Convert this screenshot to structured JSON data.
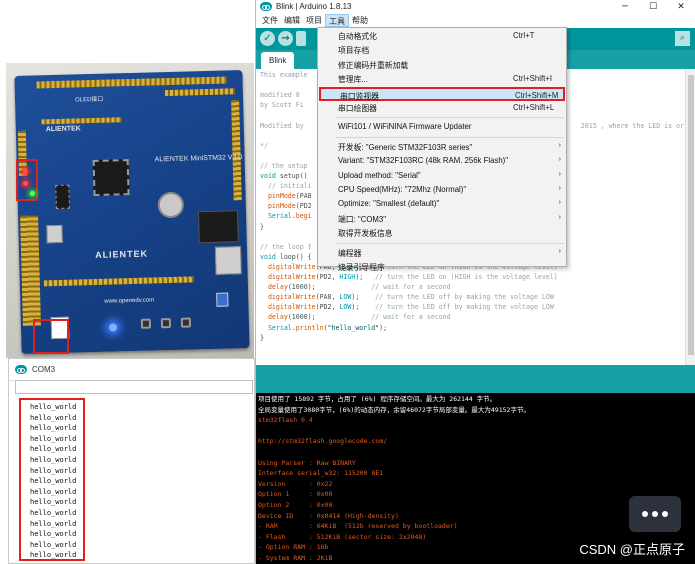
{
  "serial_window": {
    "title": "COM3",
    "output_lines": [
      "hello_world",
      "hello_world",
      "hello_world",
      "hello_world",
      "hello_world",
      "hello_world",
      "hello_world",
      "hello_world",
      "hello_world",
      "hello_world",
      "hello_world",
      "hello_world",
      "hello_world",
      "hello_world",
      "hello_world"
    ]
  },
  "board": {
    "brand": "ALIENTEK",
    "model": "ALIENTEK MiniSTM32 V3.0",
    "oled_label": "OLED接口",
    "website": "www.openedv.com"
  },
  "ide": {
    "window_title": "Blink | Arduino 1.8.13",
    "window_controls": [
      "─",
      "☐",
      "✕"
    ],
    "menu": [
      "文件",
      "编辑",
      "项目",
      "工具",
      "帮助"
    ],
    "active_menu_index": 3,
    "tab": "Blink",
    "code_lines": [
      {
        "y": 0,
        "parts": [
          [
            "This example",
            "cm"
          ]
        ]
      },
      {
        "y": 2,
        "parts": [
          [
            "modified 8",
            "cm"
          ]
        ]
      },
      {
        "y": 3,
        "parts": [
          [
            "by Scott Fi",
            "cm"
          ]
        ]
      },
      {
        "y": 5,
        "parts": [
          [
            "Modified by",
            "cm"
          ]
        ]
      },
      {
        "y": 5.01,
        "parts": [
          [
            "2015 , where the LED is or",
            "cm"
          ]
        ],
        "x": "right"
      },
      {
        "y": 7,
        "parts": [
          [
            "*/",
            "cm"
          ]
        ]
      },
      {
        "y": 9,
        "parts": [
          [
            "// the setup",
            "cm"
          ]
        ]
      },
      {
        "y": 10,
        "parts": [
          [
            "void",
            "kw"
          ],
          [
            " setup() ",
            "tx"
          ]
        ]
      },
      {
        "y": 11,
        "parts": [
          [
            "  // initiali",
            "cm"
          ]
        ]
      },
      {
        "y": 12,
        "parts": [
          [
            "  ",
            "tx"
          ],
          [
            "pinMode",
            "fn"
          ],
          [
            "(PA8",
            "tx"
          ]
        ]
      },
      {
        "y": 13,
        "parts": [
          [
            "  ",
            "tx"
          ],
          [
            "pinMode",
            "fn"
          ],
          [
            "(PD2",
            "tx"
          ]
        ]
      },
      {
        "y": 14,
        "parts": [
          [
            "  ",
            "tx"
          ],
          [
            "Serial",
            "kw"
          ],
          [
            ".",
            "tx"
          ],
          [
            "begi",
            "fn"
          ]
        ]
      },
      {
        "y": 15,
        "parts": [
          [
            "}",
            "tx"
          ]
        ]
      },
      {
        "y": 17,
        "parts": [
          [
            "// the loop f",
            "cm"
          ]
        ]
      },
      {
        "y": 18,
        "parts": [
          [
            "void",
            "kw"
          ],
          [
            " loop() {",
            "tx"
          ]
        ]
      },
      {
        "y": 19,
        "parts": [
          [
            "  ",
            "tx"
          ],
          [
            "digitalWrite",
            "fn"
          ],
          [
            "(PA8, ",
            "tx"
          ],
          [
            "HIGH",
            "cn"
          ],
          [
            ");   ",
            "tx"
          ],
          [
            "// turn the LED on (HIGH is the voltage level)",
            "cm"
          ]
        ]
      },
      {
        "y": 20,
        "parts": [
          [
            "  ",
            "tx"
          ],
          [
            "digitalWrite",
            "fn"
          ],
          [
            "(PD2, ",
            "tx"
          ],
          [
            "HIGH",
            "cn"
          ],
          [
            ");   ",
            "tx"
          ],
          [
            "// turn the LED on (HIGH is the voltage level)",
            "cm"
          ]
        ]
      },
      {
        "y": 21,
        "parts": [
          [
            "  ",
            "tx"
          ],
          [
            "delay",
            "fn"
          ],
          [
            "(1000);              ",
            "tx"
          ],
          [
            "// wait for a second",
            "cm"
          ]
        ]
      },
      {
        "y": 22,
        "parts": [
          [
            "  ",
            "tx"
          ],
          [
            "digitalWrite",
            "fn"
          ],
          [
            "(PA8, ",
            "tx"
          ],
          [
            "LOW",
            "cn"
          ],
          [
            ");    ",
            "tx"
          ],
          [
            "// turn the LED off by making the voltage LOW",
            "cm"
          ]
        ]
      },
      {
        "y": 23,
        "parts": [
          [
            "  ",
            "tx"
          ],
          [
            "digitalWrite",
            "fn"
          ],
          [
            "(PD2, ",
            "tx"
          ],
          [
            "LOW",
            "cn"
          ],
          [
            ");    ",
            "tx"
          ],
          [
            "// turn the LED off by making the voltage LOW",
            "cm"
          ]
        ]
      },
      {
        "y": 24,
        "parts": [
          [
            "  ",
            "tx"
          ],
          [
            "delay",
            "fn"
          ],
          [
            "(1000);              ",
            "tx"
          ],
          [
            "// wait for a second",
            "cm"
          ]
        ]
      },
      {
        "y": 25,
        "parts": [
          [
            "  ",
            "tx"
          ],
          [
            "Serial",
            "kw"
          ],
          [
            ".",
            "tx"
          ],
          [
            "println",
            "fn"
          ],
          [
            "(",
            "tx"
          ],
          [
            "\"hello_world\"",
            "st"
          ],
          [
            ");",
            "tx"
          ]
        ]
      },
      {
        "y": 26,
        "parts": [
          [
            "}",
            "tx"
          ]
        ]
      }
    ],
    "console_lines": [
      {
        "text": "项目使用了 15892 字节，占用了 (6%) 程序存储空间。最大为 262144 字节。",
        "c": "w"
      },
      {
        "text": "全局变量使用了3080字节，(6%)的动态内存，余留46072字节局部变量。最大为49152字节。",
        "c": "w"
      },
      {
        "text": "stm32flash 0.4",
        "c": "o"
      },
      {
        "text": "",
        "c": "o"
      },
      {
        "text": "http://stm32flash.googlecode.com/",
        "c": "o"
      },
      {
        "text": "",
        "c": "o"
      },
      {
        "text": "Using Parser : Raw BINARY",
        "c": "o"
      },
      {
        "text": "Interface serial_w32: 115200 8E1",
        "c": "o"
      },
      {
        "text": "Version      : 0x22",
        "c": "o"
      },
      {
        "text": "Option 1     : 0x00",
        "c": "o"
      },
      {
        "text": "Option 2     : 0x00",
        "c": "o"
      },
      {
        "text": "Device ID    : 0x0414 (High-density)",
        "c": "o"
      },
      {
        "text": "- RAM        : 64KiB  (512b reserved by bootloader)",
        "c": "o"
      },
      {
        "text": "- Flash      : 512KiB (sector size: 2x2048)",
        "c": "o"
      },
      {
        "text": "- Option RAM : 16b",
        "c": "o"
      },
      {
        "text": "- System RAM : 2KiB",
        "c": "o"
      }
    ],
    "watermark": "CSDN @正点原子"
  },
  "tools_menu": {
    "items": [
      {
        "label": "自动格式化",
        "shortcut": "Ctrl+T",
        "sub": false,
        "sep_after": false
      },
      {
        "label": "项目存档",
        "shortcut": "",
        "sub": false,
        "sep_after": false
      },
      {
        "label": "修正编码并重新加载",
        "shortcut": "",
        "sub": false,
        "sep_after": false
      },
      {
        "label": "管理库...",
        "shortcut": "Ctrl+Shift+I",
        "sub": false,
        "sep_after": false
      },
      {
        "label": "串口监视器",
        "shortcut": "Ctrl+Shift+M",
        "sub": false,
        "sep_after": false,
        "highlight": true
      },
      {
        "label": "串口绘图器",
        "shortcut": "Ctrl+Shift+L",
        "sub": false,
        "sep_after": true
      },
      {
        "label": "WiFi101 / WiFiNINA Firmware Updater",
        "shortcut": "",
        "sub": false,
        "sep_after": true
      },
      {
        "label": "开发板: \"Generic STM32F103R series\"",
        "shortcut": "",
        "sub": true,
        "sep_after": false
      },
      {
        "label": "Variant: \"STM32F103RC (48k RAM. 256k Flash)\"",
        "shortcut": "",
        "sub": true,
        "sep_after": false
      },
      {
        "label": "Upload method: \"Serial\"",
        "shortcut": "",
        "sub": true,
        "sep_after": false
      },
      {
        "label": "CPU Speed(MHz): \"72Mhz (Normal)\"",
        "shortcut": "",
        "sub": true,
        "sep_after": false
      },
      {
        "label": "Optimize: \"Smallest (default)\"",
        "shortcut": "",
        "sub": true,
        "sep_after": false
      },
      {
        "label": "端口: \"COM3\"",
        "shortcut": "",
        "sub": true,
        "sep_after": false
      },
      {
        "label": "取得开发板信息",
        "shortcut": "",
        "sub": false,
        "sep_after": true
      },
      {
        "label": "编程器",
        "shortcut": "",
        "sub": true,
        "sep_after": false
      },
      {
        "label": "烧录引导程序",
        "shortcut": "",
        "sub": false,
        "sep_after": false
      }
    ]
  }
}
